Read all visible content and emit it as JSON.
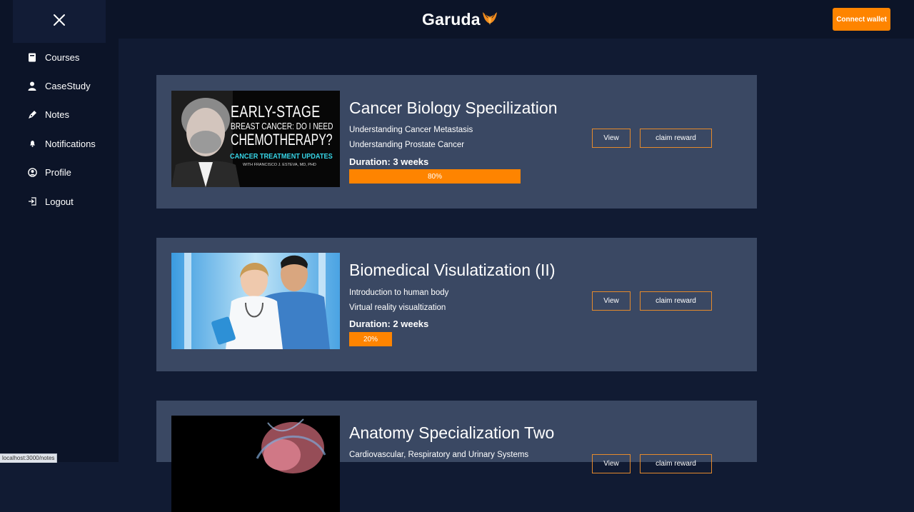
{
  "brand": {
    "name": "Garuda"
  },
  "header": {
    "connect_label": "Connect wallet"
  },
  "sidebar": {
    "items": [
      {
        "label": "Courses",
        "icon": "book-icon"
      },
      {
        "label": "CaseStudy",
        "icon": "user-icon"
      },
      {
        "label": "Notes",
        "icon": "pen-icon"
      },
      {
        "label": "Notifications",
        "icon": "bell-icon"
      },
      {
        "label": "Profile",
        "icon": "profile-icon"
      },
      {
        "label": "Logout",
        "icon": "logout-icon"
      }
    ]
  },
  "courses": [
    {
      "title": "Cancer Biology Specilization",
      "topics": [
        "Understanding Cancer Metastasis",
        "Understanding Prostate Cancer"
      ],
      "duration": "Duration: 3 weeks",
      "progress_label": "80%",
      "progress": 1.0,
      "view_label": "View",
      "claim_label": "claim reward",
      "thumb": {
        "headline1": "EARLY-STAGE",
        "headline2": "BREAST CANCER: DO I NEED",
        "headline3": "CHEMOTHERAPY?",
        "series": "CANCER TREATMENT UPDATES",
        "byline": "WITH FRANCISCO J. ESTEVA, MD, PHD"
      }
    },
    {
      "title": "Biomedical Visulatization (II)",
      "topics": [
        "Introduction to human body",
        "Virtual reality visualtization"
      ],
      "duration": "Duration: 2 weeks",
      "progress_label": "20%",
      "progress": 0.25,
      "view_label": "View",
      "claim_label": "claim reward"
    },
    {
      "title": "Anatomy Specialization Two",
      "topics": [
        "Cardiovascular, Respiratory and Urinary Systems"
      ],
      "view_label": "View",
      "claim_label": "claim reward"
    }
  ],
  "status_bar": {
    "url": "localhost:3000/notes"
  },
  "colors": {
    "accent": "#fe8400",
    "card": "#3a4863",
    "background": "#111b33",
    "sidebar": "#0c1428"
  }
}
